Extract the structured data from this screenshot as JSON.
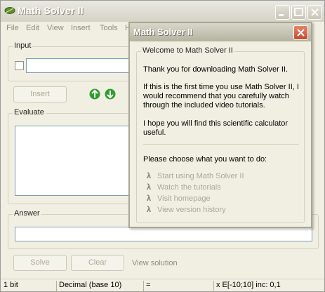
{
  "app": {
    "title": "Math Solver II",
    "buttons": {
      "minimize": "minimize",
      "maximize": "maximize",
      "close": "close"
    }
  },
  "menu": [
    "File",
    "Edit",
    "View",
    "Insert",
    "Tools",
    "H"
  ],
  "input_group": {
    "label": "Input",
    "insert_button": "Insert"
  },
  "evaluate_group": {
    "label": "Evaluate"
  },
  "answer_group": {
    "label": "Answer"
  },
  "actions": {
    "solve": "Solve",
    "clear": "Clear",
    "view_solution": "View solution"
  },
  "status": {
    "bits": "1 bit",
    "base": "Decimal (base 10)",
    "equals": "=",
    "range": "x E[-10;10] inc: 0,1"
  },
  "dialog": {
    "title": "Math Solver II",
    "group_label": "Welcome to Math Solver II",
    "thanks": "Thank you for downloading Math Solver II.",
    "recommend": "If this is the first time you use Math Solver II, I would recommend that you carefully watch through the included video tutorials.",
    "hope": " I hope you will find this scientific calculator useful.",
    "choose": "Please choose what you want to do:",
    "bullet": "λ",
    "options": [
      "Start using Math Solver II",
      "Watch the tutorials",
      "Visit homepage",
      "View version history"
    ]
  },
  "colors": {
    "accent_green": "#2e9e2e",
    "close_red": "#d25a3c",
    "disabled_text": "#aca899"
  },
  "icons": {
    "app": "app-leaf-icon",
    "up": "arrow-up-icon",
    "down": "arrow-down-icon"
  }
}
